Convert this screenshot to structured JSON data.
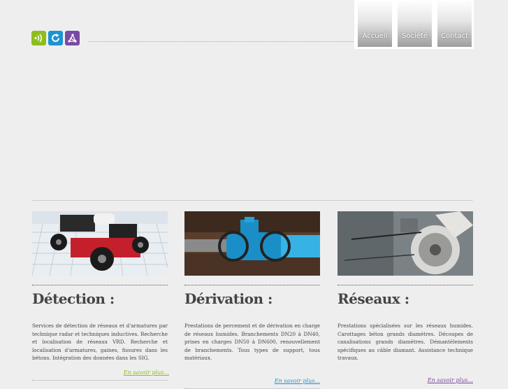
{
  "nav": {
    "items": [
      "Accueil",
      "Société",
      "Contact"
    ]
  },
  "icons": [
    {
      "name": "wave-icon",
      "color": "#8dbe1e"
    },
    {
      "name": "refresh-icon",
      "color": "#1e93d3"
    },
    {
      "name": "network-icon",
      "color": "#7a4aa3"
    }
  ],
  "columns": [
    {
      "title": "Détection :",
      "text": "Services de détection de réseaux et d'armatures par technique radar et techniques inductives. Recherche et localisation de réseaux VRD. Recherche et localisation d'armatures, gaines, fissures dans les bétons. Intégration des données dans les SIG.",
      "more": "En savoir plus...",
      "more_color": "#8dbe1e"
    },
    {
      "title": "Dérivation :",
      "text": "Prestations de percement et de dérivation en charge de réseaux humides. Branchements DN20 à DN40, prises en charges DN50 à DN600, renouvellement de branchements. Tous types de support, tous matériaux.",
      "more": "En savoir plus...",
      "more_color": "#1e93d3"
    },
    {
      "title": "Réseaux :",
      "text": "Prestations spécialisées sur les réseaux humides. Carottages béton grands diamètres. Découpes de canalisations grands diamètres. Démantèlements spécifiques au câble diamant. Assistance technique travaux.",
      "more": "En savoir plus...",
      "more_color": "#7a4aa3"
    }
  ]
}
